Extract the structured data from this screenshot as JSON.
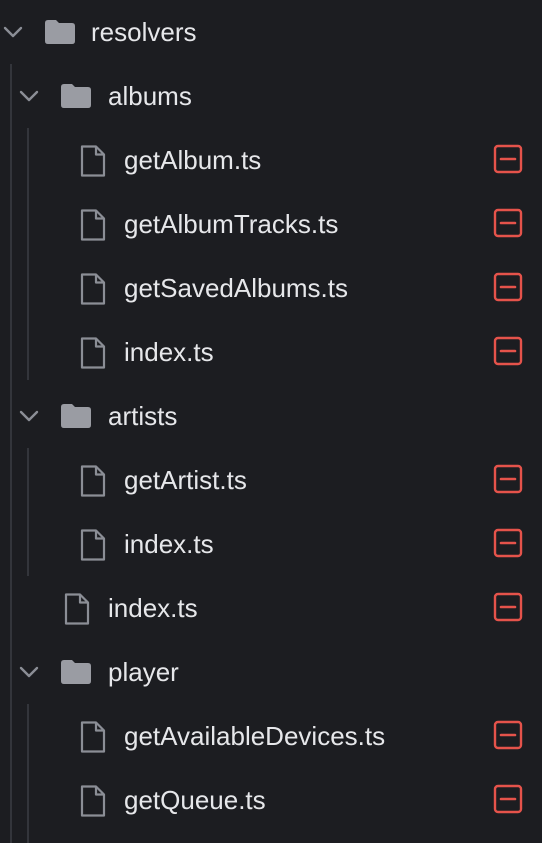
{
  "explorer": {
    "root": {
      "label": "resolvers",
      "icon": "folder-icon",
      "expanded": true
    },
    "folders": {
      "albums": {
        "label": "albums",
        "icon": "folder-icon",
        "expanded": true,
        "files": [
          {
            "label": "getAlbum.ts",
            "status": "deleted"
          },
          {
            "label": "getAlbumTracks.ts",
            "status": "deleted"
          },
          {
            "label": "getSavedAlbums.ts",
            "status": "deleted"
          },
          {
            "label": "index.ts",
            "status": "deleted"
          }
        ]
      },
      "artists": {
        "label": "artists",
        "icon": "folder-icon",
        "expanded": true,
        "files": [
          {
            "label": "getArtist.ts",
            "status": "deleted"
          },
          {
            "label": "index.ts",
            "status": "deleted"
          }
        ]
      },
      "player": {
        "label": "player",
        "icon": "folder-icon",
        "expanded": true,
        "files": [
          {
            "label": "getAvailableDevices.ts",
            "status": "deleted"
          },
          {
            "label": "getQueue.ts",
            "status": "deleted"
          }
        ]
      }
    },
    "root_files": [
      {
        "label": "index.ts",
        "status": "deleted"
      }
    ]
  },
  "colors": {
    "background": "#1c1d21",
    "text": "#e6e7ea",
    "icon": "#8b8e96",
    "folder": "#9a9ca3",
    "deleted": "#e5534b",
    "guide": "#33353b"
  }
}
